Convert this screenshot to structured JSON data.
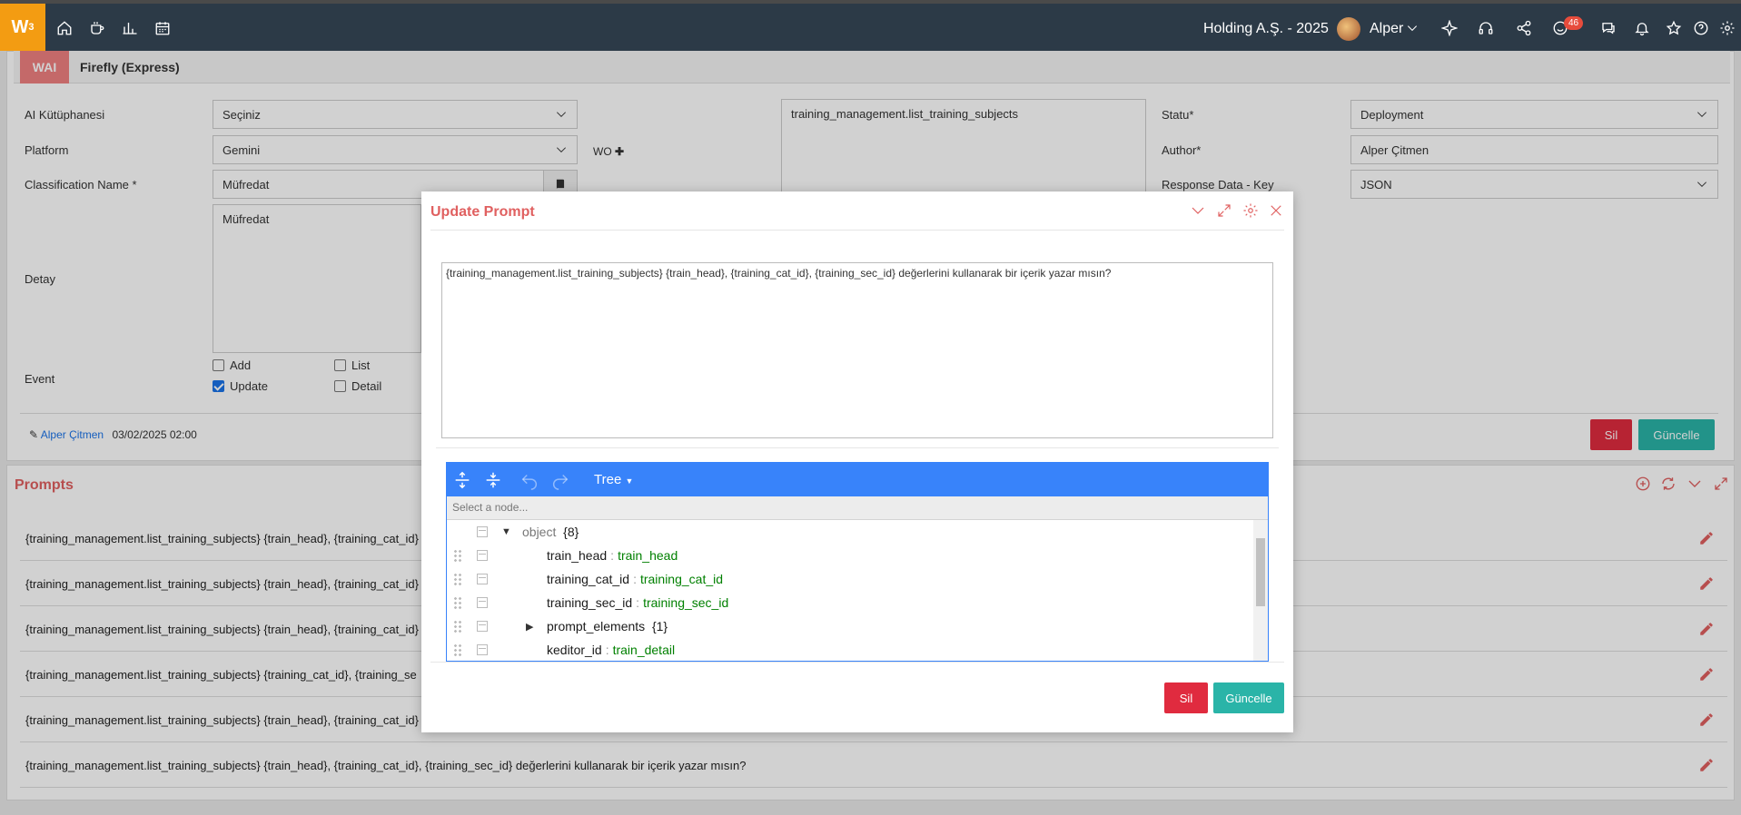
{
  "app": {
    "logo_text": "W",
    "logo_sup": "3",
    "company": "Holding A.Ş. - 2025",
    "user": "Alper",
    "notification_count": "46"
  },
  "form": {
    "tag": "WAI",
    "title": "Firefly (Express)",
    "ai_library_label": "AI Kütüphanesi",
    "ai_library_value": "Seçiniz",
    "platform_label": "Platform",
    "platform_value": "Gemini",
    "classification_label": "Classification Name *",
    "classification_value": "Müfredat",
    "detail_label": "Detay",
    "detail_value": "Müfredat",
    "wo_label": "WO",
    "wo_text": "training_management.list_training_subjects",
    "status_label": "Statu*",
    "status_value": "Deployment",
    "author_label": "Author*",
    "author_value": "Alper Çitmen",
    "response_label": "Response Data - Key",
    "response_value": "JSON",
    "event_label": "Event",
    "events": {
      "add": "Add",
      "list": "List",
      "update": "Update",
      "detail": "Detail"
    },
    "editor_name": "Alper Çitmen",
    "edit_date": "03/02/2025 02:00",
    "delete_label": "Sil",
    "update_label": "Güncelle"
  },
  "prompts": {
    "title": "Prompts",
    "rows": [
      "{training_management.list_training_subjects} {train_head}, {training_cat_id}",
      "{training_management.list_training_subjects} {train_head}, {training_cat_id}",
      "{training_management.list_training_subjects} {train_head}, {training_cat_id}",
      "{training_management.list_training_subjects} {training_cat_id}, {training_se",
      "{training_management.list_training_subjects} {train_head}, {training_cat_id}",
      "{training_management.list_training_subjects} {train_head}, {training_cat_id}, {training_sec_id} değerlerini kullanarak bir içerik yazar mısın?"
    ]
  },
  "modal": {
    "title": "Update Prompt",
    "prompt_text": "{training_management.list_training_subjects} {train_head}, {training_cat_id}, {training_sec_id} değerlerini kullanarak bir içerik yazar mısın?",
    "editor_mode": "Tree",
    "node_placeholder": "Select a node...",
    "root_label": "object",
    "root_count": "{8}",
    "nodes": [
      {
        "key": "train_head",
        "value": "train_head"
      },
      {
        "key": "training_cat_id",
        "value": "training_cat_id"
      },
      {
        "key": "training_sec_id",
        "value": "training_sec_id"
      },
      {
        "key": "prompt_elements",
        "count": "{1}"
      },
      {
        "key": "keditor_id",
        "value": "train_detail"
      }
    ],
    "delete_label": "Sil",
    "update_label": "Güncelle"
  },
  "colors": {
    "topbar": "#2c3a47",
    "logo": "#f39c12",
    "accent_red": "#e06060",
    "button_red": "#e02b3f",
    "button_teal": "#2ab4a8",
    "jsoneditor_blue": "#3883fa"
  }
}
